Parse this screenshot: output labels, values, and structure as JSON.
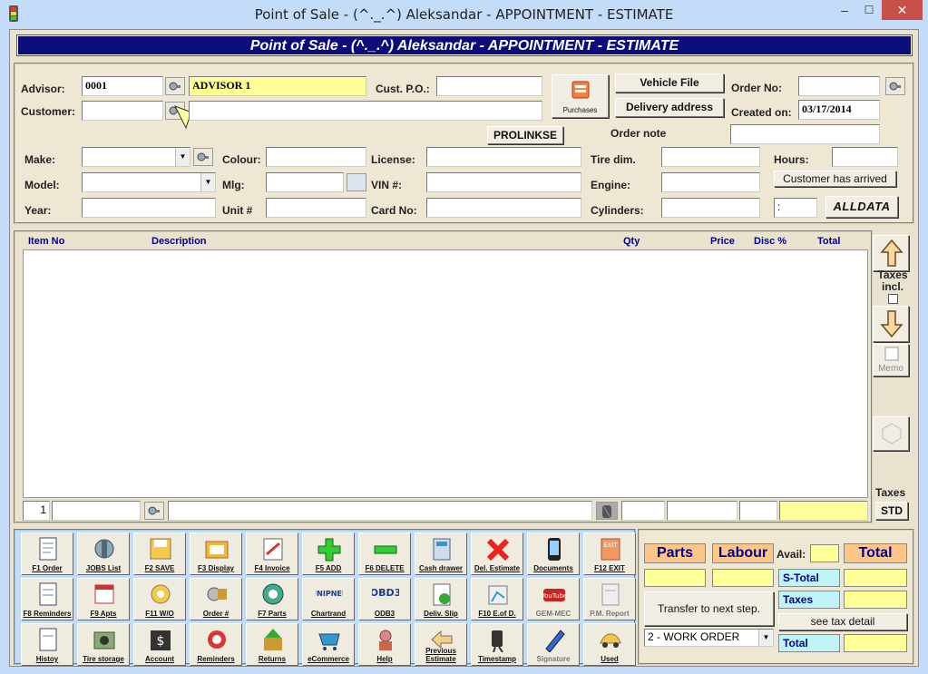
{
  "window": {
    "title": "Point of Sale - (^._.^) Aleksandar - APPOINTMENT - ESTIMATE",
    "min": "–",
    "max": "☐",
    "close": "✕"
  },
  "banner": "Point of Sale - (^._.^) Aleksandar - APPOINTMENT - ESTIMATE",
  "header": {
    "advisor_label": "Advisor:",
    "advisor_code": "0001",
    "advisor_name": "ADVISOR 1",
    "customer_label": "Customer:",
    "customer_code": "",
    "customer_name": "",
    "cust_po_label": "Cust. P.O.:",
    "cust_po": "",
    "purchases": "Purchases",
    "vehicle_file": "Vehicle File",
    "delivery_address": "Delivery address",
    "order_no_label": "Order No:",
    "order_no": "",
    "created_on_label": "Created on:",
    "created_on": "03/17/2014",
    "order_note_label": "Order note",
    "order_note": "",
    "prolinks": "PROLINKSE"
  },
  "vehicle": {
    "make_label": "Make:",
    "make": "",
    "model_label": "Model:",
    "model": "",
    "year_label": "Year:",
    "year": "",
    "colour_label": "Colour:",
    "colour": "",
    "mlg_label": "Mlg:",
    "mlg": "",
    "unit_label": "Unit #",
    "unit": "",
    "license_label": "License:",
    "license": "",
    "vin_label": "VIN #:",
    "vin": "",
    "card_label": "Card No:",
    "card": "",
    "tire_label": "Tire dim.",
    "tire": "",
    "engine_label": "Engine:",
    "engine": "",
    "cyl_label": "Cylinders:",
    "cyl": "",
    "hours_label": "Hours:",
    "hours": "",
    "arrived": "Customer has arrived",
    "cyl_sep": ":",
    "alldata": "ALLDATA"
  },
  "grid": {
    "columns": [
      "Item No",
      "Description",
      "Qty",
      "Price",
      "Disc %",
      "Total"
    ],
    "line_no": "1"
  },
  "side": {
    "taxes_incl": "Taxes incl.",
    "memo": "Memo",
    "taxes": "Taxes",
    "std": "STD"
  },
  "toolbar": [
    [
      "F1 Order",
      "JOBS List",
      "F2 SAVE",
      "F3 Display",
      "F4 Invoice",
      "F5 ADD",
      "F6 DELETE",
      "Cash drawer",
      "Del. Estimate",
      "Documents",
      "F12 EXIT"
    ],
    [
      "F8 Reminders",
      "F9 Apts",
      "F11 W/O",
      "Order #",
      "F7 Parts",
      "Chartrand",
      "ODB3",
      "Deliv. Slip",
      "F10 E.of D.",
      "GEM-MEC",
      "P.M. Report"
    ],
    [
      "Histoy",
      "Tire storage",
      "Account",
      "Reminders",
      "Returns",
      "eCommerce",
      "Help",
      "Previous Estimate",
      "Timestamp",
      "Signature",
      "Used"
    ]
  ],
  "logos": {
    "unipneu": "UNIPNEU",
    "obd": "OBD3",
    "youtube": "YouTube",
    "exit": "EXIT"
  },
  "summary": {
    "parts": "Parts",
    "labour": "Labour",
    "avail": "Avail:",
    "total": "Total",
    "s_total": "S-Total",
    "taxes": "Taxes",
    "total2": "Total",
    "transfer": "Transfer to next step.",
    "see_tax": "see tax detail",
    "work_order": "2 - WORK ORDER"
  }
}
